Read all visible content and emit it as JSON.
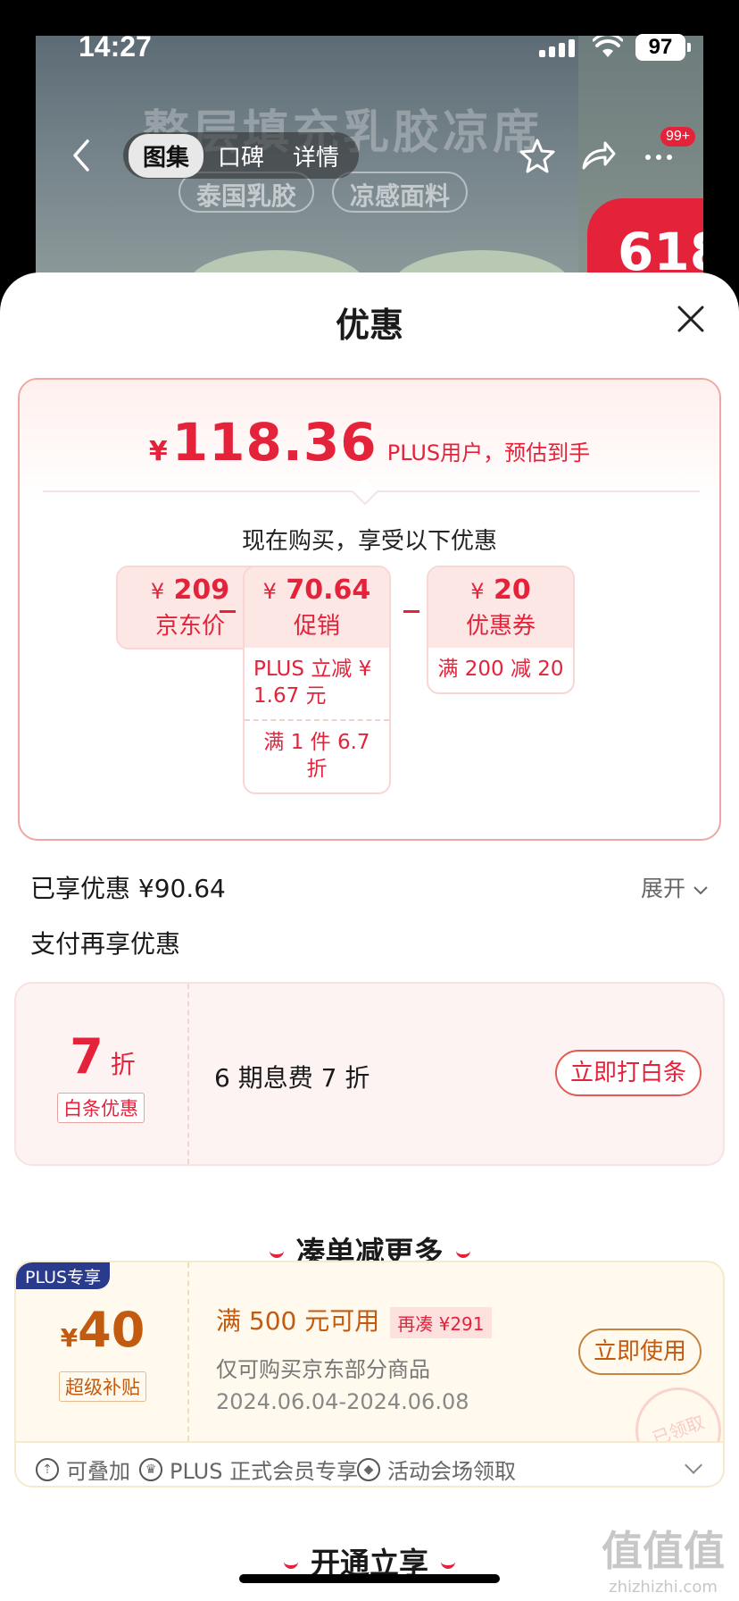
{
  "status_bar": {
    "time": "14:27",
    "battery": "97"
  },
  "banner": {
    "headline": "整层填充乳胶凉席",
    "chips": [
      "泰国乳胶",
      "凉感面料"
    ],
    "promo_badge": "618"
  },
  "nav": {
    "tabs": [
      {
        "label": "图集",
        "active": true
      },
      {
        "label": "口碑",
        "active": false
      },
      {
        "label": "详情",
        "active": false
      }
    ],
    "message_badge": "99+"
  },
  "sheet": {
    "title": "优惠",
    "final_price": {
      "currency": "¥",
      "amount": "118.36",
      "note": "PLUS用户，预估到手"
    },
    "buy_hint": "现在购买，享受以下优惠",
    "breakdown": [
      {
        "currency": "¥",
        "amount": "209",
        "label": "京东价",
        "details": []
      },
      {
        "currency": "¥",
        "amount": "70.64",
        "label": "促销",
        "details": [
          "PLUS 立减 ¥ 1.67 元",
          "满 1 件 6.7 折"
        ]
      },
      {
        "currency": "¥",
        "amount": "20",
        "label": "优惠券",
        "details": [
          "满 200 减 20"
        ]
      }
    ],
    "enjoyed": "已享优惠 ¥90.64",
    "expand_label": "展开",
    "pay_more_title": "支付再享优惠",
    "baitiao": {
      "discount_value": "7",
      "discount_unit": "折",
      "tag": "白条优惠",
      "description": "6 期息费 7 折",
      "button": "立即打白条"
    },
    "bundle_title": "凑单减更多",
    "coupon": {
      "plus_tag": "PLUS专享",
      "currency": "¥",
      "amount": "40",
      "tag": "超级补贴",
      "condition": "满 500 元可用",
      "again_tag": "再凑 ¥291",
      "scope": "仅可购买京东部分商品",
      "dates": "2024.06.04-2024.06.08",
      "button": "立即使用",
      "stamp": "已领取",
      "features": [
        "可叠加",
        "PLUS 正式会员专享",
        "活动会场领取"
      ]
    },
    "open_title": "开通立享"
  },
  "watermark": {
    "main": "值值值",
    "sub": "zhizhizhi.com"
  },
  "colors": {
    "accent_red": "#e4233b",
    "coupon_gold": "#c25a0f",
    "plus_blue": "#2a3a8c"
  }
}
